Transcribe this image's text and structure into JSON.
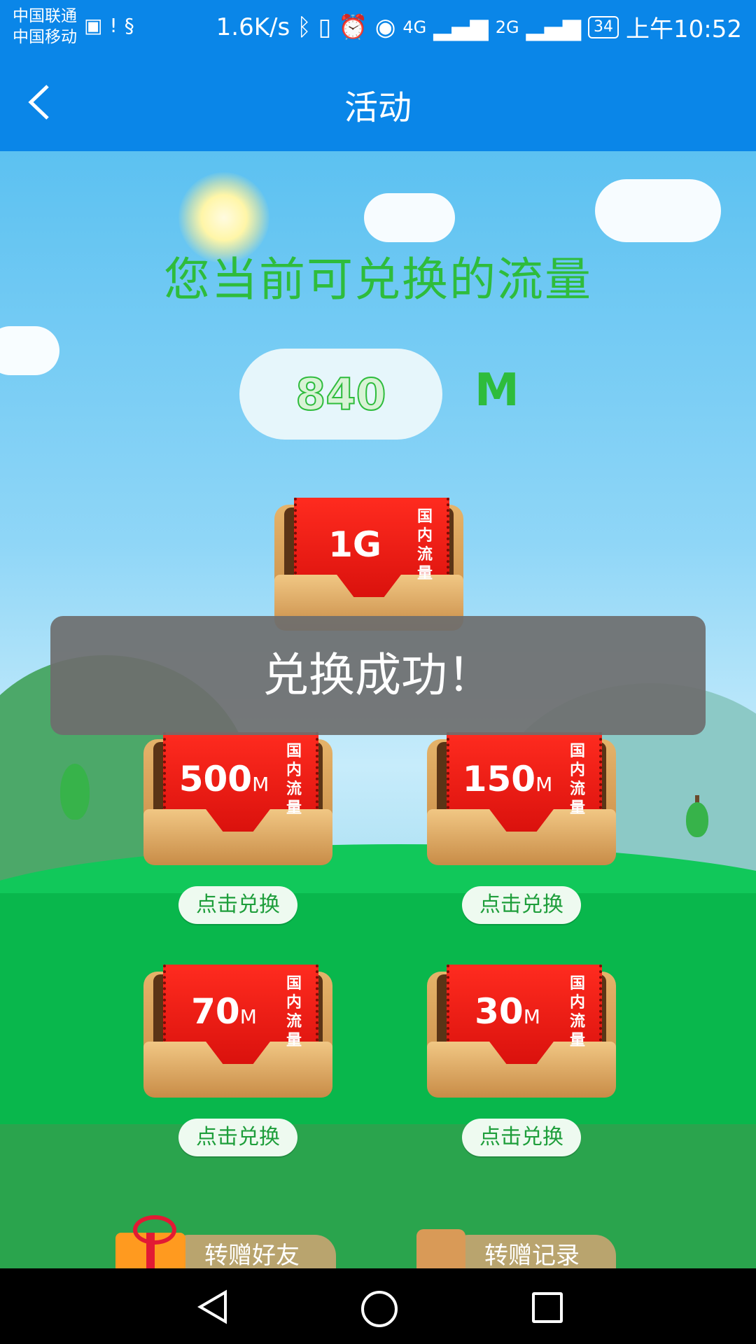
{
  "status_bar": {
    "carrier1": "中国联通",
    "carrier2": "中国移动",
    "speed": "1.6K/s",
    "net1": "4G",
    "net2": "2G",
    "battery": "34",
    "time": "上午10:52"
  },
  "header": {
    "title": "活动"
  },
  "main": {
    "headline": "您当前可兑换的流量",
    "balance_value": "840",
    "balance_unit": "M",
    "tag_vertical": "国内流量",
    "packages": [
      {
        "amount": "1G",
        "unit": ""
      },
      {
        "amount": "500",
        "unit": "M"
      },
      {
        "amount": "150",
        "unit": "M"
      },
      {
        "amount": "70",
        "unit": "M"
      },
      {
        "amount": "30",
        "unit": "M"
      }
    ],
    "exchange_label": "点击兑换"
  },
  "bottom": {
    "gift_friend": "转赠好友",
    "gift_record": "转赠记录"
  },
  "toast": {
    "message": "兑换成功！"
  },
  "colors": {
    "primary": "#0a86e8",
    "headline_green": "#2ebc3c",
    "ticket_red": "#e8140f",
    "toast_bg": "#6e6e6e"
  }
}
